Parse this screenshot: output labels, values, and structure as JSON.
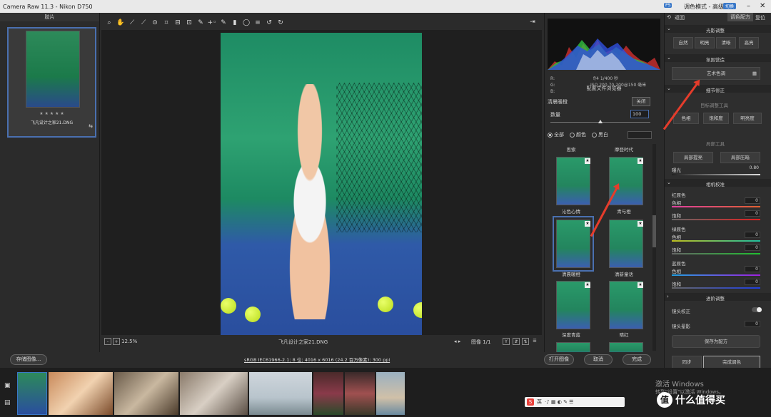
{
  "titlebar": {
    "title": "Camera Raw 11.3  -  Nikon D750",
    "mode_label": "调色模式 - 高级",
    "badge": "PS",
    "mini_label": "切换"
  },
  "filmstrip": {
    "header": "胶片",
    "stars": "★ ★ ★ ★ ★",
    "filename": "飞凡设计之家21.DNG"
  },
  "toolbar": {
    "icons": [
      "zoom-icon",
      "hand-icon",
      "white-balance-icon",
      "color-sampler-icon",
      "target-adjust-icon",
      "crop-icon",
      "straighten-icon",
      "transform-icon",
      "spot-removal-icon",
      "red-eye-icon",
      "brush-icon",
      "graduated-filter-icon",
      "radial-filter-icon",
      "preferences-icon",
      "rotate-ccw-icon",
      "rotate-cw-icon"
    ]
  },
  "canvas": {
    "zoom": "12.5%",
    "filename": "飞凡设计之家21.DNG",
    "pager": "图像 1/1",
    "y_label": "Y"
  },
  "bottom": {
    "save_label": "存储图像...",
    "workflow": "sRGB IEC61966-2.1; 8 位; 4016 x 6016 (24.2 百万像素); 300 ppi",
    "open_label": "打开图像",
    "cancel_label": "取消",
    "done_label": "完成"
  },
  "histogram": {
    "r_label": "R:",
    "g_label": "G:",
    "b_label": "B:",
    "line1": "f/4   1/400 秒",
    "line2": "ISO 200   70-200@150 毫米"
  },
  "presets": {
    "title": "配置文件浏览器",
    "selected_name": "清晨暖橙",
    "close_label": "关闭",
    "amount_label": "数量",
    "amount_value": "100",
    "amount": 100,
    "filters": {
      "all": "全部",
      "color": "颜色",
      "bw": "黑白"
    },
    "top_labels": [
      "思索",
      "摩登时代"
    ],
    "items": [
      {
        "name": "沁色心情"
      },
      {
        "name": "青与橙"
      },
      {
        "name": "清晨暖橙"
      },
      {
        "name": "清新童话"
      },
      {
        "name": "深度青蓝"
      },
      {
        "name": "晴红"
      }
    ]
  },
  "right": {
    "back": "返回",
    "tabs": [
      "调色配方",
      "复位"
    ],
    "sections": {
      "light": "光影调整",
      "atmosphere": "氛围营造",
      "detail": "细节修正",
      "camera": "相机校准",
      "advanced": "进阶调整"
    },
    "light_buttons": [
      "自然",
      "明亮",
      "清晰",
      "高亮"
    ],
    "art_color": "艺术色调",
    "target_tool": "目标调整工具",
    "target_buttons": [
      "色相",
      "饱和度",
      "明亮度"
    ],
    "local_tool": "局部工具",
    "local_buttons": [
      "局部提亮",
      "局部压暗"
    ],
    "exposure_label": "曝光",
    "exposure_value": "0.80",
    "primaries": [
      {
        "name": "红原色",
        "hue_label": "色相",
        "hue_value": "0",
        "sat_label": "饱和",
        "sat_value": "0"
      },
      {
        "name": "绿原色",
        "hue_label": "色相",
        "hue_value": "0",
        "sat_label": "饱和",
        "sat_value": "0"
      },
      {
        "name": "蓝原色",
        "hue_label": "色相",
        "hue_value": "0",
        "sat_label": "饱和",
        "sat_value": "0"
      }
    ],
    "lens_label": "镜头校正",
    "vignette_label": "镜头晕影",
    "vignette_value": "0",
    "save_recipe": "保存为配方",
    "sync": "同步",
    "finish": "完成调色"
  },
  "watermark": {
    "line1": "激活 Windows",
    "line2": "转到\"设置\"以激活 Windows。"
  },
  "brand": {
    "logo_text": "什么值得买",
    "logo_glyph": "值"
  },
  "ime": {
    "label": "英"
  },
  "colors": {
    "accent": "#4a70b0",
    "arrow": "#e53c2b"
  }
}
